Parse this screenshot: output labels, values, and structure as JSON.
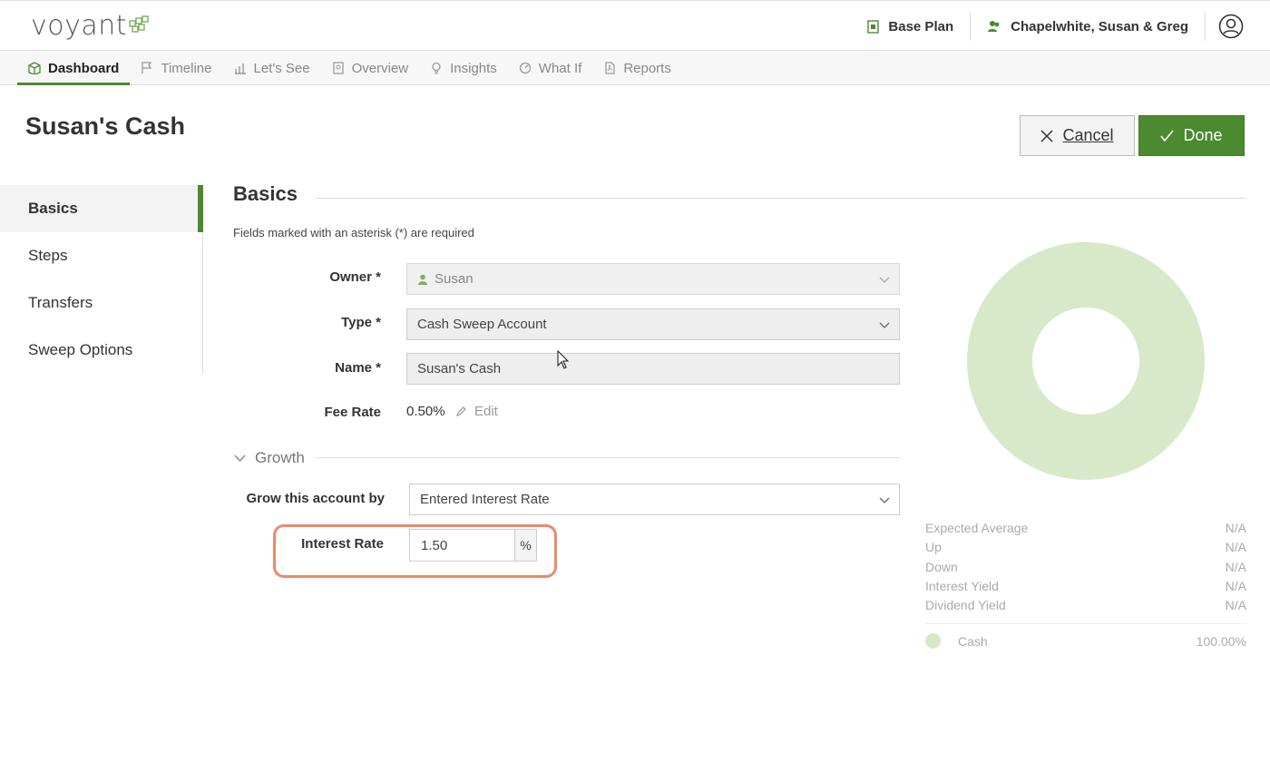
{
  "brand": {
    "logo_text": "voyant",
    "accent": "#4b8a2e"
  },
  "header": {
    "plan_label": "Base Plan",
    "client_label": "Chapelwhite, Susan & Greg"
  },
  "nav": {
    "tabs": [
      {
        "label": "Dashboard",
        "icon": "dashboard-icon",
        "active": true
      },
      {
        "label": "Timeline",
        "icon": "flag-icon"
      },
      {
        "label": "Let's See",
        "icon": "bar-chart-icon"
      },
      {
        "label": "Overview",
        "icon": "document-icon"
      },
      {
        "label": "Insights",
        "icon": "lightbulb-icon"
      },
      {
        "label": "What If",
        "icon": "gauge-icon"
      },
      {
        "label": "Reports",
        "icon": "pdf-icon"
      }
    ]
  },
  "page": {
    "title": "Susan's Cash",
    "cancel_label": "Cancel",
    "done_label": "Done"
  },
  "sidebar": {
    "items": [
      {
        "label": "Basics"
      },
      {
        "label": "Steps"
      },
      {
        "label": "Transfers"
      },
      {
        "label": "Sweep Options"
      }
    ]
  },
  "basics": {
    "title": "Basics",
    "required_note": "Fields marked with an asterisk (*) are required",
    "owner_label": "Owner *",
    "owner_value": "Susan",
    "type_label": "Type *",
    "type_value": "Cash Sweep Account",
    "name_label": "Name *",
    "name_value": "Susan's Cash",
    "fee_label": "Fee Rate",
    "fee_value": "0.50%",
    "fee_edit": "Edit"
  },
  "growth": {
    "title": "Growth",
    "grow_label": "Grow this account by",
    "grow_value": "Entered Interest Rate",
    "rate_label": "Interest Rate",
    "rate_value": "1.50",
    "rate_unit": "%"
  },
  "stats": {
    "rows": [
      {
        "label": "Expected Average",
        "value": "N/A"
      },
      {
        "label": "Up",
        "value": "N/A"
      },
      {
        "label": "Down",
        "value": "N/A"
      },
      {
        "label": "Interest Yield",
        "value": "N/A"
      },
      {
        "label": "Dividend Yield",
        "value": "N/A"
      }
    ],
    "legend_label": "Cash",
    "legend_value": "100.00%",
    "legend_color": "#d7e9c8"
  }
}
